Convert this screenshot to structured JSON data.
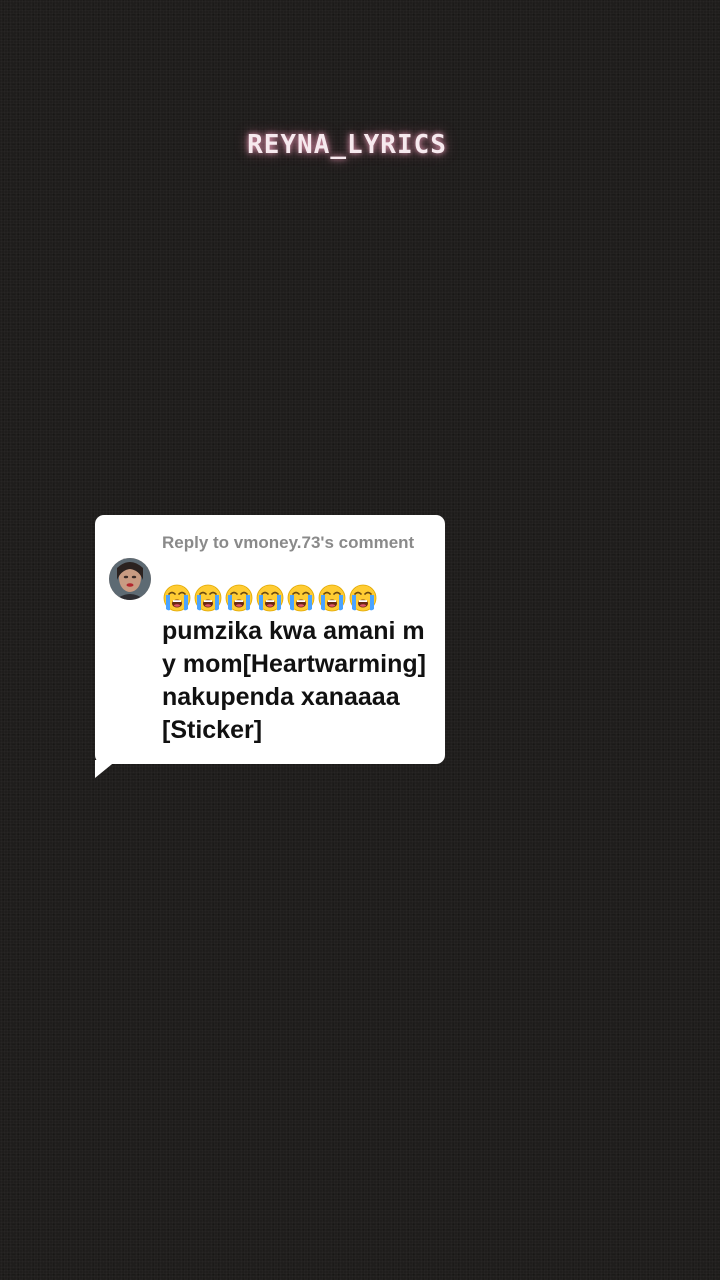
{
  "watermark": {
    "text": "REYNA_LYRICS"
  },
  "reply_card": {
    "header": "Reply to vmoney.73's comment",
    "emoji_icon": "loudly-crying-face",
    "emoji_count": 7,
    "body": "pumzika kwa amani my mom[Heartwarming]nakupenda xanaaaa [Sticker]"
  },
  "colors": {
    "background": "#1f1d1c",
    "card": "#ffffff",
    "header_text": "#8a8a8a",
    "body_text": "#111111",
    "watermark": "#f6e9ee"
  }
}
